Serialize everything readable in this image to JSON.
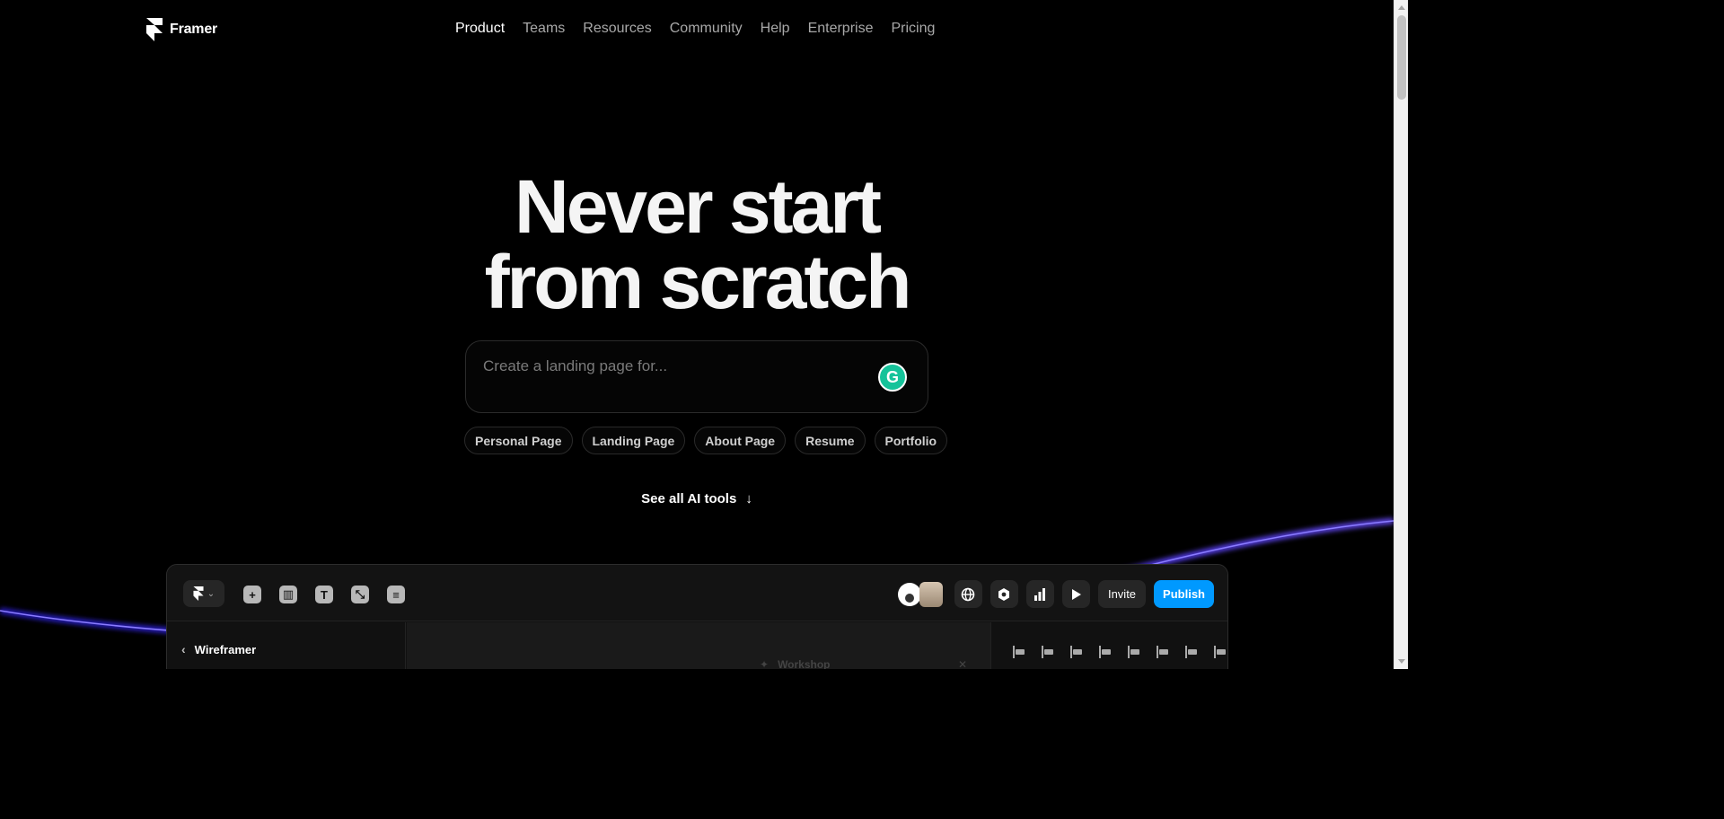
{
  "brand": {
    "name": "Framer",
    "icon": "framer-logo-icon"
  },
  "nav": {
    "items": [
      {
        "label": "Product",
        "active": true
      },
      {
        "label": "Teams",
        "active": false
      },
      {
        "label": "Resources",
        "active": false
      },
      {
        "label": "Community",
        "active": false
      },
      {
        "label": "Help",
        "active": false
      },
      {
        "label": "Enterprise",
        "active": false
      },
      {
        "label": "Pricing",
        "active": false
      }
    ]
  },
  "hero": {
    "line1": "Never start",
    "line2": "from scratch"
  },
  "prompt": {
    "placeholder": "Create a landing page for...",
    "value": "",
    "assistant_icon": "grammarly-icon",
    "assistant_letter": "G"
  },
  "chips": [
    "Personal Page",
    "Landing Page",
    "About Page",
    "Resume",
    "Portfolio"
  ],
  "see_all": {
    "label": "See all AI tools",
    "icon": "arrow-down-icon",
    "glyph": "↓"
  },
  "app_preview": {
    "toolbar_left_icons": [
      "insert-icon",
      "layout-icon",
      "text-icon",
      "vector-icon",
      "cms-icon"
    ],
    "toolbar_right_icons": [
      "globe-icon",
      "plugins-icon",
      "analytics-icon",
      "play-icon"
    ],
    "invite_label": "Invite",
    "publish_label": "Publish",
    "left_panel_title": "Wireframer",
    "canvas_tab": "Workshop",
    "colors": {
      "publish": "#0099ff"
    }
  },
  "colors": {
    "background": "#000000",
    "wave": "#5b3cff"
  }
}
